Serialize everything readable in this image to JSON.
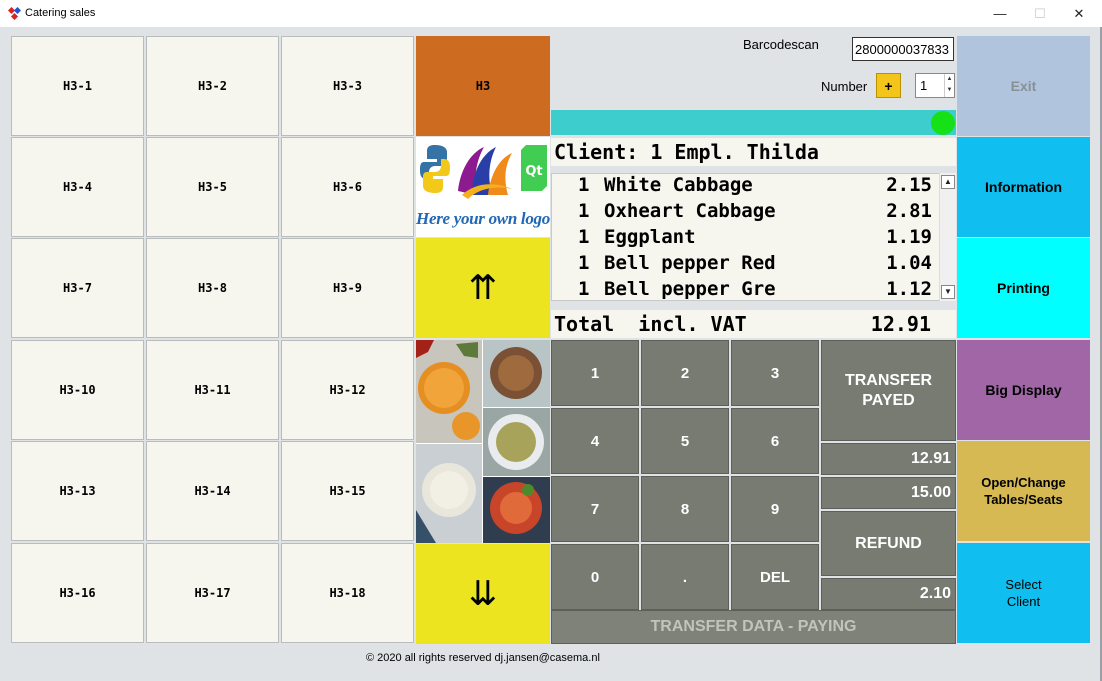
{
  "window": {
    "title": "Catering sales",
    "min": "—",
    "max": "☐",
    "close": "✕"
  },
  "grid_buttons": [
    "H3-1",
    "H3-2",
    "H3-3",
    "H3-4",
    "H3-5",
    "H3-6",
    "H3-7",
    "H3-8",
    "H3-9",
    "H3-10",
    "H3-11",
    "H3-12",
    "H3-13",
    "H3-14",
    "H3-15",
    "H3-16",
    "H3-17",
    "H3-18"
  ],
  "category": {
    "label": "H3",
    "color": "#cd6c20"
  },
  "logo": {
    "text": "Here your own logo",
    "icons": [
      "python-logo-icon",
      "brand-logo-icon",
      "qt-logo-icon"
    ]
  },
  "nav": {
    "up": "⇈",
    "down": "⇊",
    "color": "#ebe41e"
  },
  "barcode": {
    "label": "Barcodescan",
    "value": "2800000037833"
  },
  "number": {
    "label": "Number",
    "plus": "+",
    "value": "1"
  },
  "status": {
    "indicator_color": "#16e016"
  },
  "client_line": "Client: 1 Empl. Thilda",
  "orders": [
    {
      "qty": "1",
      "name": "White Cabbage",
      "price": "2.15"
    },
    {
      "qty": "1",
      "name": "Oxheart Cabbage",
      "price": "2.81"
    },
    {
      "qty": "1",
      "name": "Eggplant",
      "price": "1.19"
    },
    {
      "qty": "1",
      "name": "Bell pepper Red",
      "price": "1.04"
    },
    {
      "qty": "1",
      "name": "Bell pepper Gre",
      "price": "1.12"
    }
  ],
  "total": {
    "label": "Total  incl. VAT",
    "value": "12.91"
  },
  "keypad": [
    "1",
    "2",
    "3",
    "4",
    "5",
    "6",
    "7",
    "8",
    "9",
    "0",
    ".",
    "DEL"
  ],
  "payment": {
    "transfer_payed": "TRANSFER PAYED",
    "amount_due": "12.91",
    "amount_given": "15.00",
    "refund_label": "REFUND",
    "refund_amount": "2.10",
    "transfer_data": "TRANSFER DATA - PAYING"
  },
  "side_buttons": [
    {
      "label": "Exit",
      "color": "#b0c4de",
      "text_color": "#8a8f96"
    },
    {
      "label": "Information",
      "color": "#10bfef",
      "text_color": "#000000"
    },
    {
      "label": "Printing",
      "color": "#00ffff",
      "text_color": "#000000"
    },
    {
      "label": "Big Display",
      "color": "#a066a6",
      "text_color": "#000000"
    },
    {
      "label": "Open/Change Tables/Seats",
      "color": "#d6b952",
      "text_color": "#000000"
    },
    {
      "label": "Select Client",
      "color": "#10bfef",
      "text_color": "#000000"
    }
  ],
  "footer": "© 2020 all rights reserved dj.jansen@casema.nl"
}
